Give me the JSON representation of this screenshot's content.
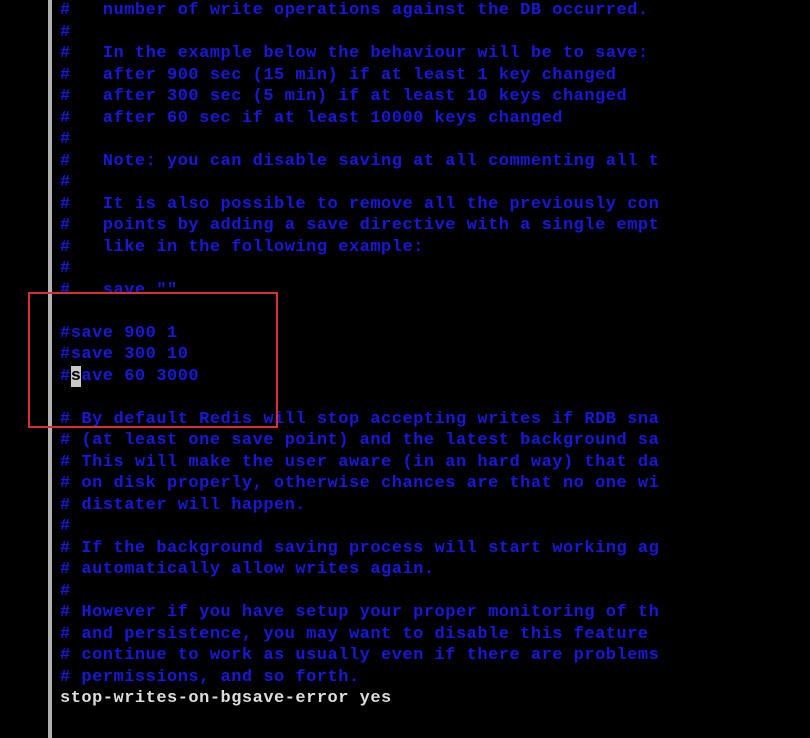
{
  "lines": [
    {
      "text": "#   number of write operations against the DB occurred.",
      "class": ""
    },
    {
      "text": "#",
      "class": ""
    },
    {
      "text": "#   In the example below the behaviour will be to save:",
      "class": ""
    },
    {
      "text": "#   after 900 sec (15 min) if at least 1 key changed",
      "class": ""
    },
    {
      "text": "#   after 300 sec (5 min) if at least 10 keys changed",
      "class": ""
    },
    {
      "text": "#   after 60 sec if at least 10000 keys changed",
      "class": ""
    },
    {
      "text": "#",
      "class": ""
    },
    {
      "text": "#   Note: you can disable saving at all commenting all t",
      "class": ""
    },
    {
      "text": "#",
      "class": ""
    },
    {
      "text": "#   It is also possible to remove all the previously con",
      "class": ""
    },
    {
      "text": "#   points by adding a save directive with a single empt",
      "class": ""
    },
    {
      "text": "#   like in the following example:",
      "class": ""
    },
    {
      "text": "#",
      "class": ""
    },
    {
      "text": "#   save \"\"",
      "class": ""
    },
    {
      "text": "",
      "class": ""
    },
    {
      "text": "#save 900 1",
      "class": ""
    },
    {
      "text": "#save 300 10",
      "class": ""
    },
    {
      "text": "",
      "class": "",
      "special": "cursor"
    },
    {
      "text": "",
      "class": ""
    },
    {
      "text": "# By default Redis will stop accepting writes if RDB sna",
      "class": ""
    },
    {
      "text": "# (at least one save point) and the latest background sa",
      "class": ""
    },
    {
      "text": "# This will make the user aware (in an hard way) that da",
      "class": ""
    },
    {
      "text": "# on disk properly, otherwise chances are that no one wi",
      "class": ""
    },
    {
      "text": "# distater will happen.",
      "class": ""
    },
    {
      "text": "#",
      "class": ""
    },
    {
      "text": "# If the background saving process will start working ag",
      "class": ""
    },
    {
      "text": "# automatically allow writes again.",
      "class": ""
    },
    {
      "text": "#",
      "class": ""
    },
    {
      "text": "# However if you have setup your proper monitoring of th",
      "class": ""
    },
    {
      "text": "# and persistence, you may want to disable this feature ",
      "class": ""
    },
    {
      "text": "# continue to work as usually even if there are problems",
      "class": ""
    },
    {
      "text": "# permissions, and so forth.",
      "class": ""
    },
    {
      "text": "stop-writes-on-bgsave-error yes",
      "class": "white"
    }
  ],
  "cursorLine": {
    "prefix": "#",
    "rest": "save 60 3000"
  }
}
